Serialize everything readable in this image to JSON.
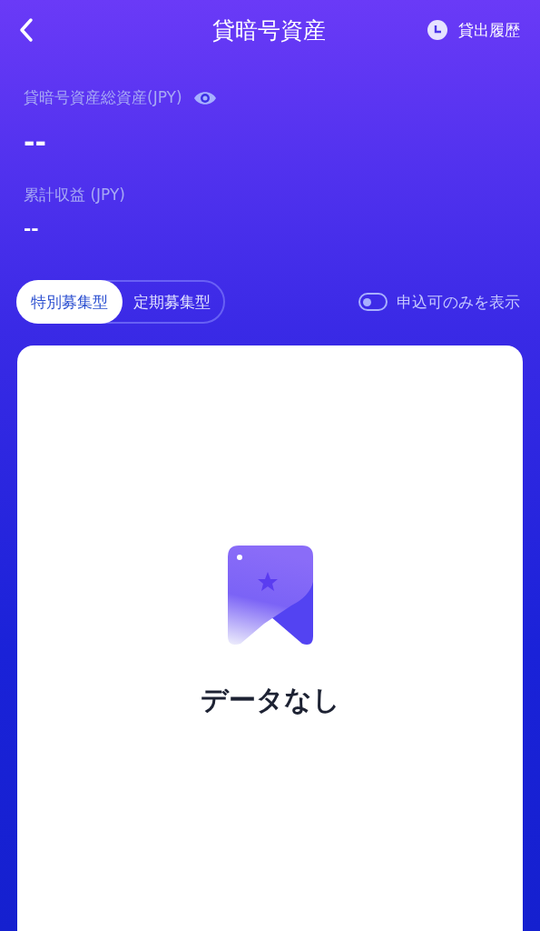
{
  "header": {
    "title": "貸暗号資産",
    "history_link": "貸出履歴"
  },
  "summary": {
    "total_label": "貸暗号資産総資産(JPY)",
    "total_value": "--",
    "earnings_label": "累計収益 (JPY)",
    "earnings_value": "--"
  },
  "tabs": [
    {
      "label": "特別募集型",
      "selected": true
    },
    {
      "label": "定期募集型",
      "selected": false
    }
  ],
  "filter": {
    "label": "申込可のみを表示",
    "on": false
  },
  "empty_state": {
    "message": "データなし"
  }
}
